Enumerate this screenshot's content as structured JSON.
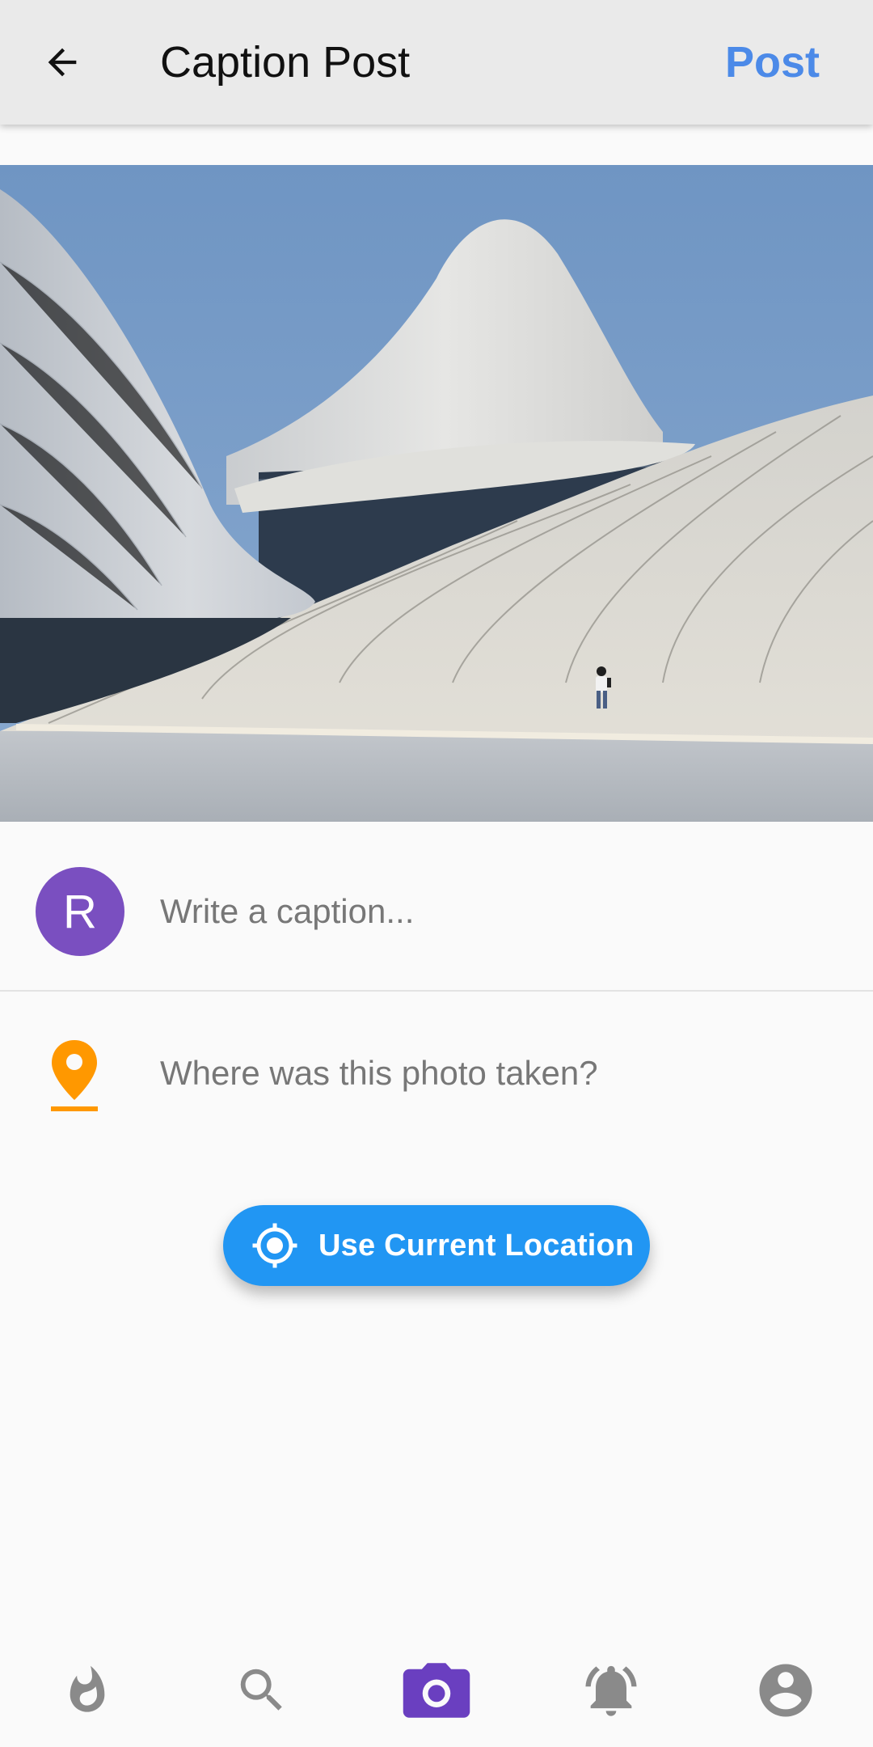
{
  "appbar": {
    "title": "Caption Post",
    "post_label": "Post"
  },
  "caption": {
    "avatar_initial": "R",
    "avatar_color": "#7a4fc0",
    "placeholder": "Write a caption..."
  },
  "location": {
    "placeholder": "Where was this photo taken?",
    "pin_color": "#ff9800",
    "use_current_label": "Use Current Location",
    "button_color": "#2196f3"
  },
  "colors": {
    "accent_post": "#4c8ae8",
    "nav_active": "#6a3fc0",
    "nav_inactive": "#8a8a8a"
  },
  "bottom_nav": {
    "items": [
      {
        "icon": "flame-icon",
        "active": false
      },
      {
        "icon": "search-icon",
        "active": false
      },
      {
        "icon": "camera-icon",
        "active": true
      },
      {
        "icon": "notifications-icon",
        "active": false
      },
      {
        "icon": "account-icon",
        "active": false
      }
    ]
  }
}
